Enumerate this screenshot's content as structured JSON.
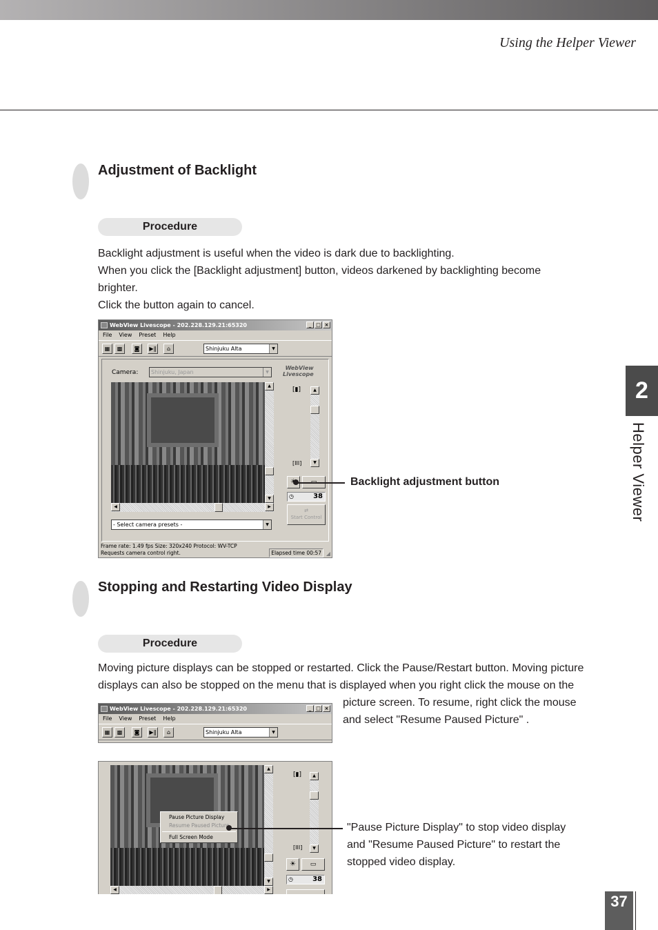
{
  "header": {
    "running_head": "Using the Helper Viewer"
  },
  "sections": [
    {
      "title": "Adjustment of Backlight",
      "procedure_label": "Procedure",
      "paragraphs": [
        "Backlight adjustment is useful when the video is dark due to backlighting.",
        "When you click the [Backlight adjustment] button, videos darkened by backlighting become",
        "brighter.",
        "Click the button again to cancel."
      ],
      "callout": "Backlight adjustment button"
    },
    {
      "title": "Stopping and Restarting Video Display",
      "procedure_label": "Procedure",
      "paragraphs": [
        "Moving picture displays can be stopped or restarted. Click the Pause/Restart button. Moving picture",
        "displays can also be stopped on the menu that is displayed when you right click the mouse on the",
        "picture screen. To resume, right click the mouse",
        "and select \"Resume Paused Picture\" ."
      ],
      "callout_lines": [
        "\"Pause Picture Display\" to stop video display",
        "and \"Resume Paused Picture\" to restart the",
        "stopped video display."
      ]
    }
  ],
  "app_window": {
    "title": "WebView Livescope - 202.228.129.21:65320",
    "window_buttons": [
      "_",
      "□",
      "×"
    ],
    "menu": [
      "File",
      "View",
      "Preset",
      "Help"
    ],
    "camera_combo": "Shinjuku Alta",
    "camera_label": "Camera:",
    "camera_field": "Shinjuku, Japan",
    "logo_line1": "WebView",
    "logo_line2": "Livescope",
    "timer_value": "38",
    "preset_combo": "- Select camera presets -",
    "start_control": "Start Control",
    "status_line1": "Frame rate:  1.49 fps   Size:  320x240    Protocol:  WV-TCP",
    "status_line2": "Requests camera control right.",
    "elapsed": "Elapsed time 00:57"
  },
  "context_menu": {
    "items": [
      "Pause Picture Display",
      "Resume Paused Picture",
      "Full Screen Mode"
    ],
    "disabled_item": "Resume Paused Picture"
  },
  "side_tab": {
    "chapter_number": "2",
    "chapter_label": "Helper Viewer"
  },
  "footer": {
    "page_number": "37"
  }
}
